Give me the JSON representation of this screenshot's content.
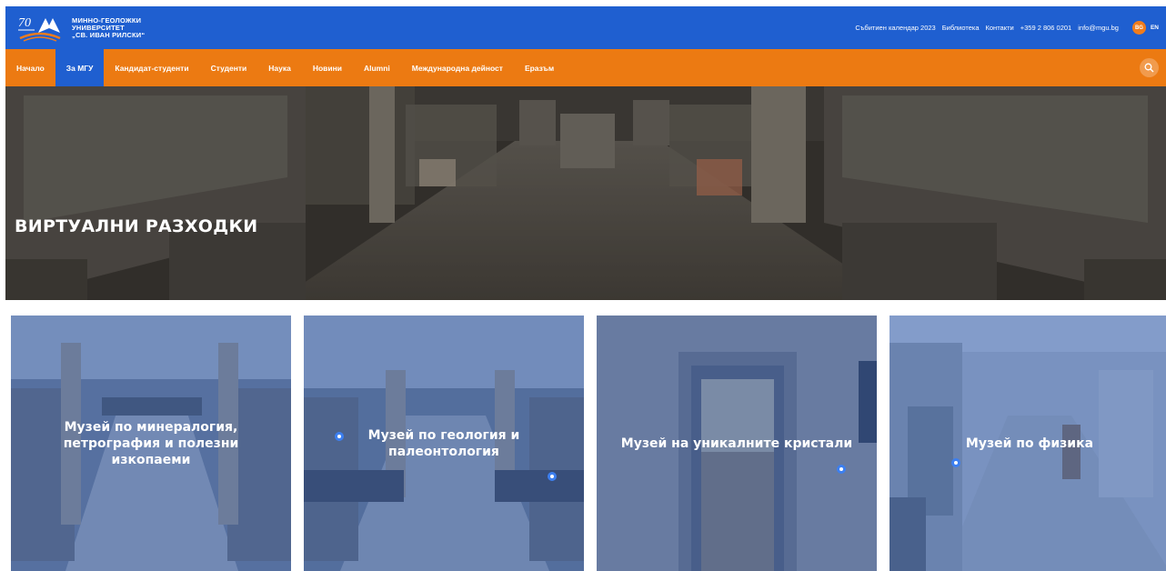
{
  "brand": {
    "line1": "МИННО-ГЕОЛОЖКИ",
    "line2": "УНИВЕРСИТЕТ",
    "line3": "„СВ. ИВАН РИЛСКИ“",
    "badge": "70"
  },
  "topbar": {
    "links": [
      "Събитиен календар 2023",
      "Библиотека",
      "Контакти",
      "+359 2 806 0201",
      "info@mgu.bg"
    ],
    "lang_active": "BG",
    "lang_other": "EN"
  },
  "nav": {
    "items": [
      "Начало",
      "За МГУ",
      "Кандидат-студенти",
      "Студенти",
      "Наука",
      "Новини",
      "Alumni",
      "Международна дейност",
      "Еразъм"
    ],
    "active_index": 1
  },
  "hero": {
    "title": "ВИРТУАЛНИ РАЗХОДКИ"
  },
  "cards": [
    {
      "title": "Музей по минералогия, петрография и полезни изкопаеми"
    },
    {
      "title": "Музей по геология и палеонтология"
    },
    {
      "title": "Музей на уникалните кристали"
    },
    {
      "title": "Музей по физика"
    }
  ],
  "colors": {
    "topbar": "#1f5fd0",
    "navbar": "#ec7a12",
    "nav_active": "#1f5fd0",
    "card_overlay": "#2654aa"
  }
}
